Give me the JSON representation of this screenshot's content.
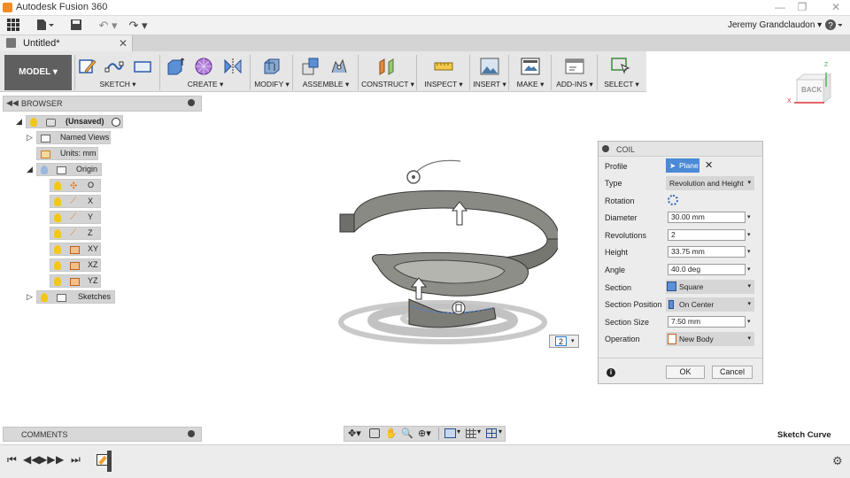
{
  "app": {
    "title": "Autodesk Fusion 360",
    "user": "Jeremy Grandclaudon"
  },
  "document": {
    "tab_title": "Untitled*"
  },
  "toolbar": {
    "workspace": "MODEL",
    "groups": [
      {
        "label": "SKETCH"
      },
      {
        "label": "CREATE"
      },
      {
        "label": "MODIFY"
      },
      {
        "label": "ASSEMBLE"
      },
      {
        "label": "CONSTRUCT"
      },
      {
        "label": "INSPECT"
      },
      {
        "label": "INSERT"
      },
      {
        "label": "MAKE"
      },
      {
        "label": "ADD-INS"
      },
      {
        "label": "SELECT"
      }
    ]
  },
  "browser": {
    "title": "BROWSER",
    "root": "(Unsaved)",
    "items": [
      "Named Views",
      "Units: mm",
      "Origin",
      "O",
      "X",
      "Y",
      "Z",
      "XY",
      "XZ",
      "YZ",
      "Sketches"
    ]
  },
  "viewcube": {
    "face": "BACK",
    "axis_z": "Z",
    "axis_x": "X"
  },
  "coil": {
    "title": "COIL",
    "profile_label": "Profile",
    "profile_value": "Plane",
    "type_label": "Type",
    "type_value": "Revolution and Height",
    "rotation_label": "Rotation",
    "diameter_label": "Diameter",
    "diameter_value": "30.00 mm",
    "revolutions_label": "Revolutions",
    "revolutions_value": "2",
    "height_label": "Height",
    "height_value": "33.75 mm",
    "angle_label": "Angle",
    "angle_value": "40.0 deg",
    "section_label": "Section",
    "section_value": "Square",
    "section_position_label": "Section Position",
    "section_position_value": "On Center",
    "section_size_label": "Section Size",
    "section_size_value": "7.50 mm",
    "operation_label": "Operation",
    "operation_value": "New Body",
    "ok_label": "OK",
    "cancel_label": "Cancel"
  },
  "canvas": {
    "revolutions_input": "2"
  },
  "comments": {
    "title": "COMMENTS"
  },
  "status": {
    "text": "Sketch Curve"
  }
}
